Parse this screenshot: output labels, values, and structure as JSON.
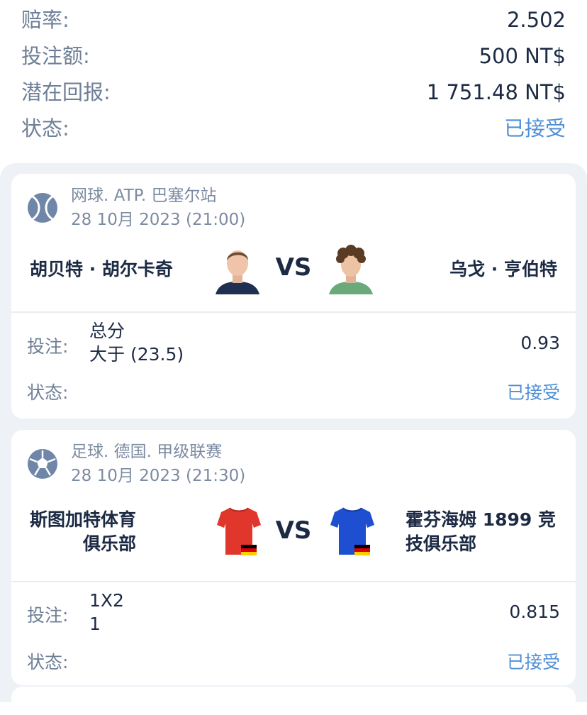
{
  "summary": {
    "odds_label": "赔率:",
    "odds_value": "2.502",
    "stake_label": "投注额:",
    "stake_value": "500 NT$",
    "return_label": "潜在回报:",
    "return_value": "1 751.48 NT$",
    "status_label": "状态:",
    "status_value": "已接受",
    "status_color": "#4f8fd6"
  },
  "bets": [
    {
      "sport_icon": "tennis-ball-icon",
      "league": "网球. ATP. 巴塞尔站",
      "date": "28 10月 2023 (21:00)",
      "team1": "胡贝特 · 胡尔卡奇",
      "team2": "乌戈 · 亨伯特",
      "vs": "VS",
      "bet_label": "投注:",
      "market_line1": "总分",
      "market_line2": "大于 (23.5)",
      "odds": "0.93",
      "status_label": "状态:",
      "status": "已接受"
    },
    {
      "sport_icon": "soccer-ball-icon",
      "league": "足球. 德国. 甲级联赛",
      "date": "28 10月 2023 (21:30)",
      "team1_line1": "斯图加特体育",
      "team1_line2": "俱乐部",
      "team2_line1": "霍芬海姆 1899 竞",
      "team2_line2": "技俱乐部",
      "vs": "VS",
      "bet_label": "投注:",
      "market_line1": "1X2",
      "market_line2": "1",
      "odds": "0.815",
      "status_label": "状态:",
      "status": "已接受",
      "team1_jersey_color": "#e0362c",
      "team2_jersey_color": "#1f4fd1"
    }
  ]
}
